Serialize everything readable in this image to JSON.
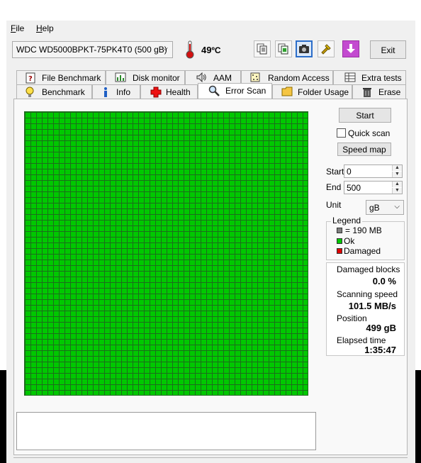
{
  "menu": {
    "file": "File",
    "file_key": "F",
    "file_rest": "ile",
    "help": "Help",
    "help_key": "H",
    "help_rest": "elp"
  },
  "toolbar": {
    "drive": "WDC WD5000BPKT-75PK4T0 (500 gB)",
    "temperature": "49",
    "temperature_unit": "ºC",
    "exit_label": "Exit",
    "icons": [
      "copy-icon",
      "copy-all-icon",
      "screenshot-icon",
      "tools-icon",
      "download-icon"
    ]
  },
  "tabs_row1": [
    "File Benchmark",
    "Disk monitor",
    "AAM",
    "Random Access",
    "Extra tests"
  ],
  "tabs_row2": [
    "Benchmark",
    "Info",
    "Health",
    "Error Scan",
    "Folder Usage",
    "Erase"
  ],
  "active_tab": "Error Scan",
  "scan": {
    "start_button": "Start",
    "quick_scan_label": "Quick scan",
    "quick_scan_checked": false,
    "speed_map_button": "Speed map",
    "start_label": "Start",
    "start_value": "0",
    "end_label": "End",
    "end_value": "500",
    "unit_label": "Unit",
    "unit_value": "gB"
  },
  "legend": {
    "title": "Legend",
    "block_size": "= 190 MB",
    "ok": "Ok",
    "damaged": "Damaged",
    "colors": {
      "block": "#808080",
      "ok": "#00c800",
      "damaged": "#e00000"
    }
  },
  "stats": {
    "damaged_blocks_label": "Damaged blocks",
    "damaged_blocks_value": "0.0 %",
    "scanning_speed_label": "Scanning speed",
    "scanning_speed_value": "101.5 MB/s",
    "position_label": "Position",
    "position_value": "499 gB",
    "elapsed_label": "Elapsed time",
    "elapsed_value": "1:35:47"
  },
  "grid": {
    "block_color": "#00c800",
    "line_color": "#1c6d1c"
  }
}
